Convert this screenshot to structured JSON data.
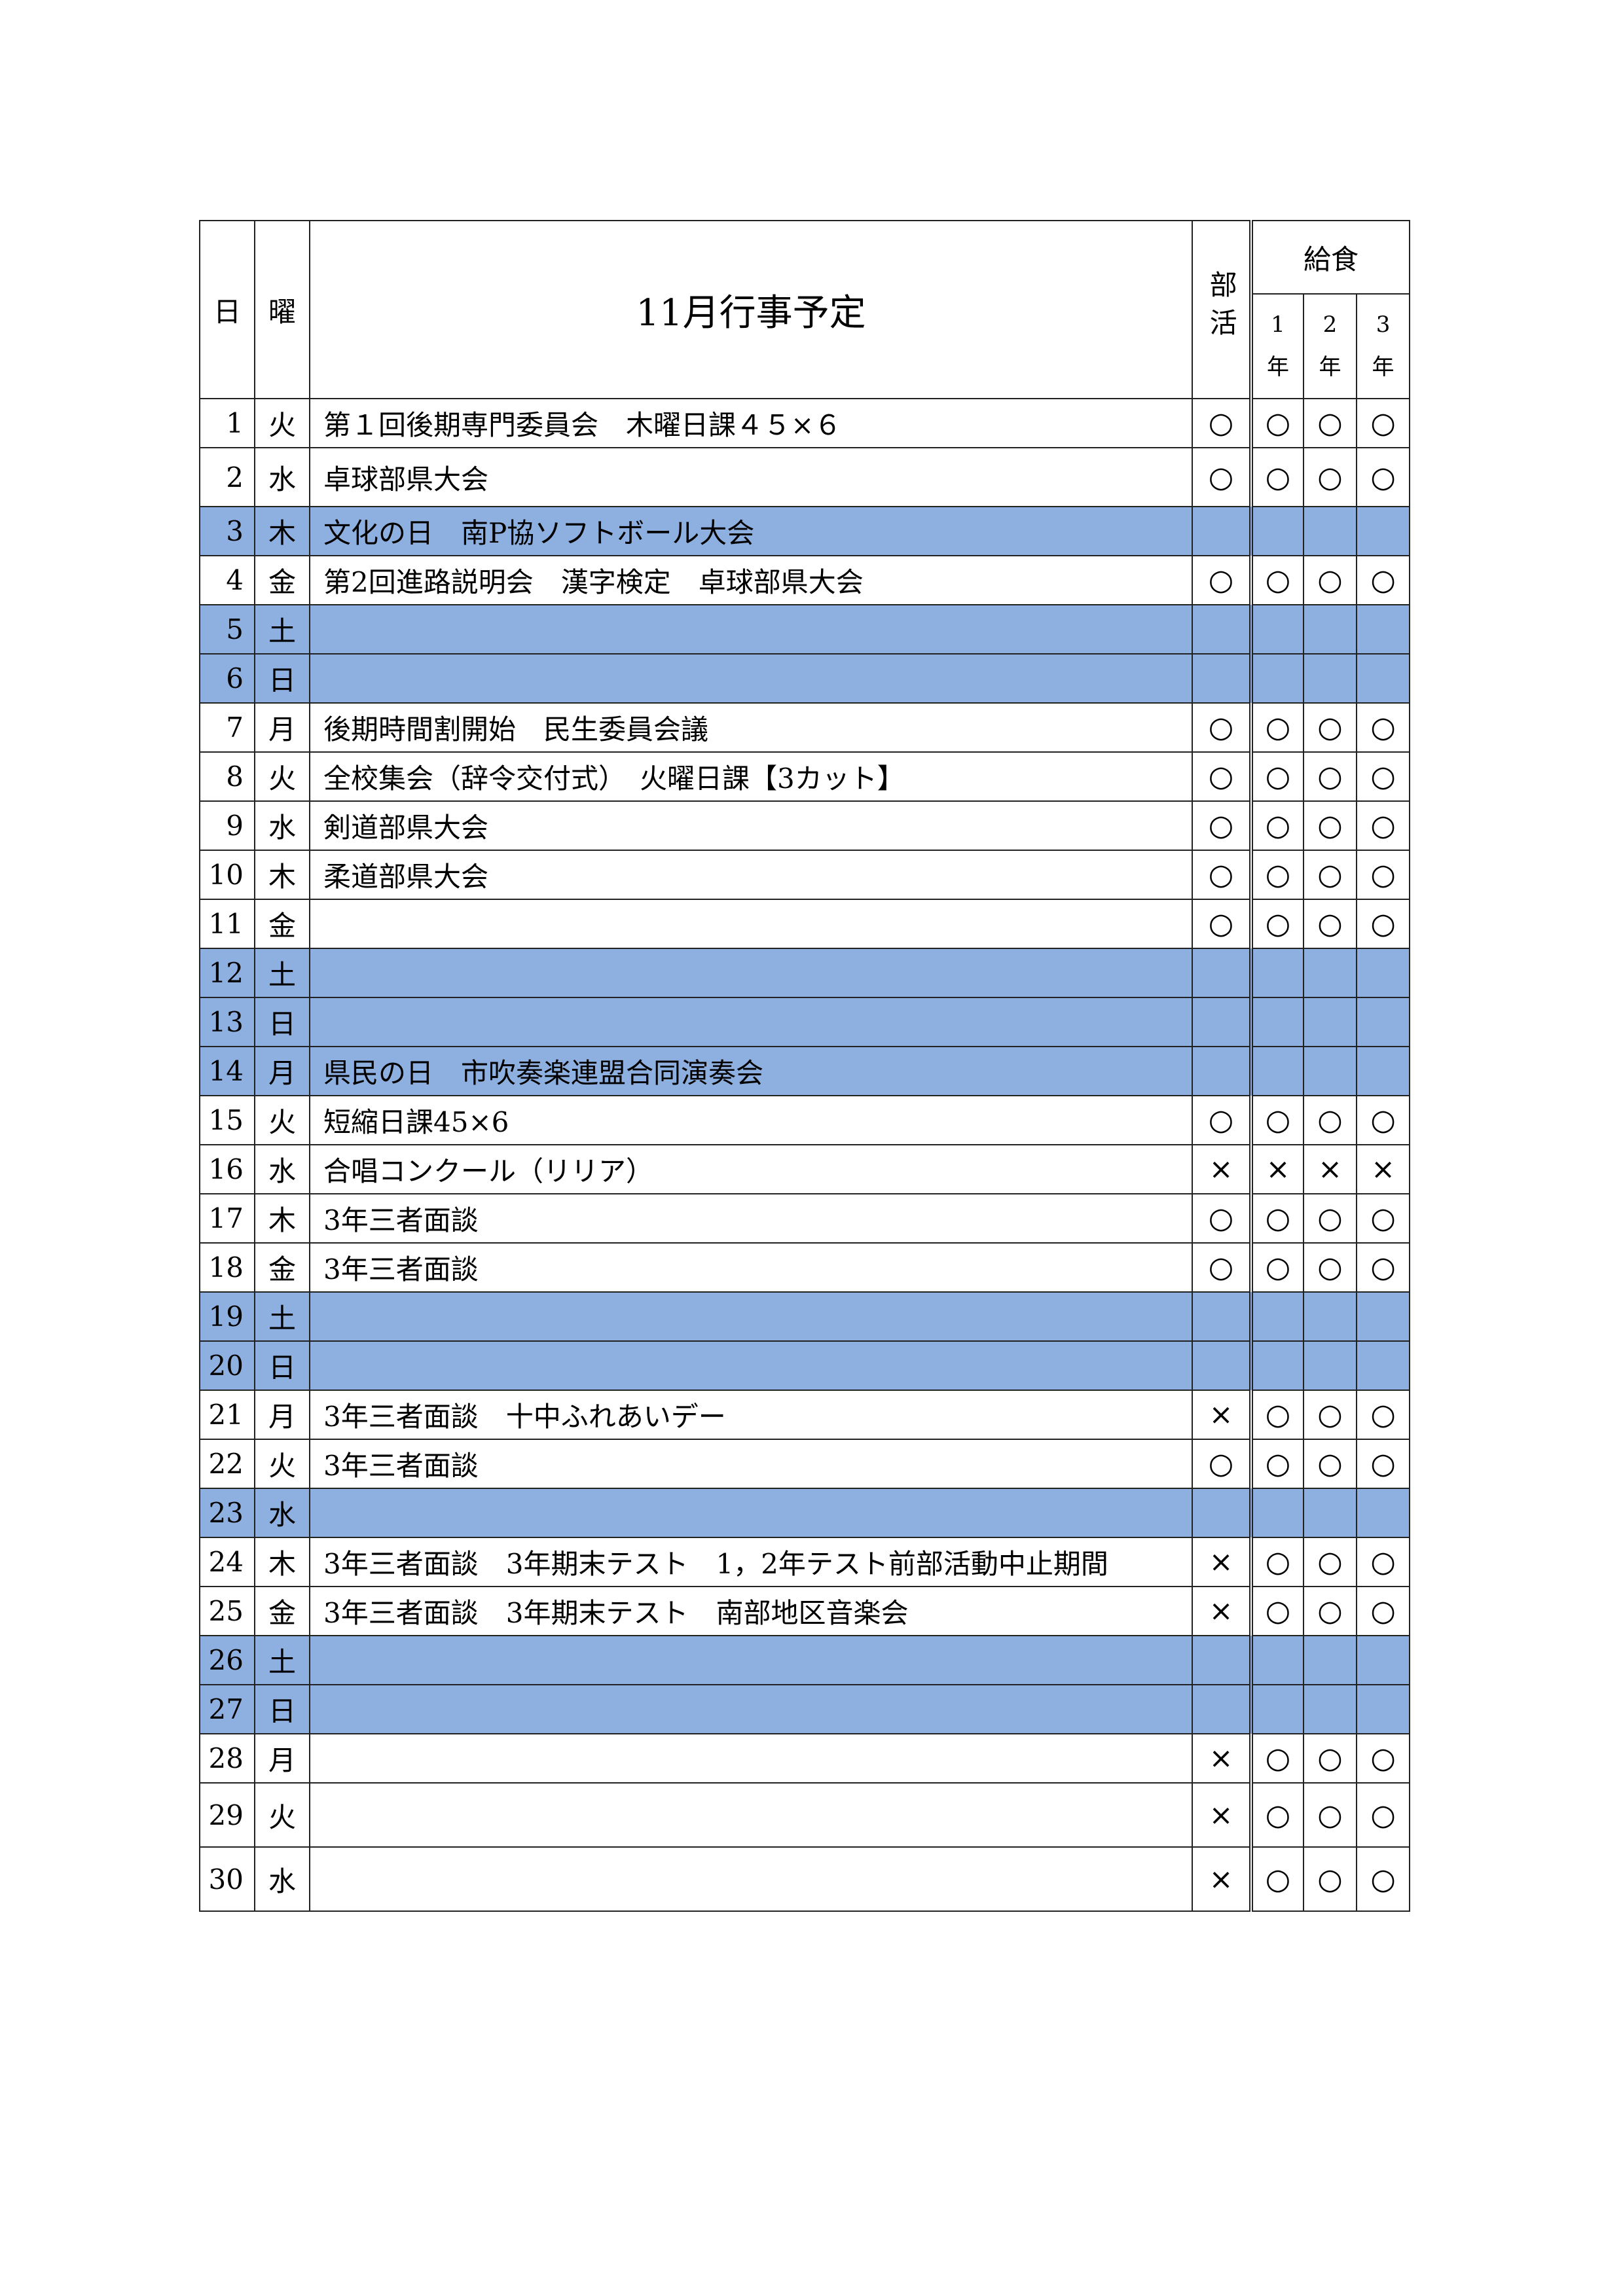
{
  "header": {
    "day_label": "日",
    "weekday_label": "曜",
    "title": "11月行事予定",
    "club_label": "部活",
    "lunch_label": "給食",
    "grades": [
      {
        "num": "1",
        "suffix": "年"
      },
      {
        "num": "2",
        "suffix": "年"
      },
      {
        "num": "3",
        "suffix": "年"
      }
    ]
  },
  "rows": [
    {
      "day": "1",
      "weekday": "火",
      "event": "第１回後期専門委員会　木曜日課４５×６",
      "club": "○",
      "g1": "○",
      "g2": "○",
      "g3": "○",
      "holiday": false
    },
    {
      "day": "2",
      "weekday": "水",
      "event": "卓球部県大会",
      "club": "○",
      "g1": "○",
      "g2": "○",
      "g3": "○",
      "holiday": false
    },
    {
      "day": "3",
      "weekday": "木",
      "event": "文化の日　南P協ソフトボール大会",
      "club": "",
      "g1": "",
      "g2": "",
      "g3": "",
      "holiday": true
    },
    {
      "day": "4",
      "weekday": "金",
      "event": "第2回進路説明会　漢字検定　卓球部県大会",
      "club": "○",
      "g1": "○",
      "g2": "○",
      "g3": "○",
      "holiday": false
    },
    {
      "day": "5",
      "weekday": "土",
      "event": "",
      "club": "",
      "g1": "",
      "g2": "",
      "g3": "",
      "holiday": true
    },
    {
      "day": "6",
      "weekday": "日",
      "event": "",
      "club": "",
      "g1": "",
      "g2": "",
      "g3": "",
      "holiday": true
    },
    {
      "day": "7",
      "weekday": "月",
      "event": "後期時間割開始　民生委員会議",
      "club": "○",
      "g1": "○",
      "g2": "○",
      "g3": "○",
      "holiday": false
    },
    {
      "day": "8",
      "weekday": "火",
      "event": "全校集会（辞令交付式）　火曜日課【3カット】",
      "club": "○",
      "g1": "○",
      "g2": "○",
      "g3": "○",
      "holiday": false
    },
    {
      "day": "9",
      "weekday": "水",
      "event": "剣道部県大会",
      "club": "○",
      "g1": "○",
      "g2": "○",
      "g3": "○",
      "holiday": false
    },
    {
      "day": "10",
      "weekday": "木",
      "event": "柔道部県大会",
      "club": "○",
      "g1": "○",
      "g2": "○",
      "g3": "○",
      "holiday": false
    },
    {
      "day": "11",
      "weekday": "金",
      "event": "",
      "club": "○",
      "g1": "○",
      "g2": "○",
      "g3": "○",
      "holiday": false
    },
    {
      "day": "12",
      "weekday": "土",
      "event": "",
      "club": "",
      "g1": "",
      "g2": "",
      "g3": "",
      "holiday": true
    },
    {
      "day": "13",
      "weekday": "日",
      "event": "",
      "club": "",
      "g1": "",
      "g2": "",
      "g3": "",
      "holiday": true
    },
    {
      "day": "14",
      "weekday": "月",
      "event": "県民の日　市吹奏楽連盟合同演奏会",
      "club": "",
      "g1": "",
      "g2": "",
      "g3": "",
      "holiday": true
    },
    {
      "day": "15",
      "weekday": "火",
      "event": "短縮日課45×6",
      "club": "○",
      "g1": "○",
      "g2": "○",
      "g3": "○",
      "holiday": false
    },
    {
      "day": "16",
      "weekday": "水",
      "event": "合唱コンクール（リリア）",
      "club": "×",
      "g1": "×",
      "g2": "×",
      "g3": "×",
      "holiday": false
    },
    {
      "day": "17",
      "weekday": "木",
      "event": "3年三者面談",
      "club": "○",
      "g1": "○",
      "g2": "○",
      "g3": "○",
      "holiday": false
    },
    {
      "day": "18",
      "weekday": "金",
      "event": "3年三者面談",
      "club": "○",
      "g1": "○",
      "g2": "○",
      "g3": "○",
      "holiday": false
    },
    {
      "day": "19",
      "weekday": "土",
      "event": "",
      "club": "",
      "g1": "",
      "g2": "",
      "g3": "",
      "holiday": true
    },
    {
      "day": "20",
      "weekday": "日",
      "event": "",
      "club": "",
      "g1": "",
      "g2": "",
      "g3": "",
      "holiday": true
    },
    {
      "day": "21",
      "weekday": "月",
      "event": "3年三者面談　十中ふれあいデー",
      "club": "×",
      "g1": "○",
      "g2": "○",
      "g3": "○",
      "holiday": false
    },
    {
      "day": "22",
      "weekday": "火",
      "event": "3年三者面談",
      "club": "○",
      "g1": "○",
      "g2": "○",
      "g3": "○",
      "holiday": false
    },
    {
      "day": "23",
      "weekday": "水",
      "event": "",
      "club": "",
      "g1": "",
      "g2": "",
      "g3": "",
      "holiday": true
    },
    {
      "day": "24",
      "weekday": "木",
      "event": "3年三者面談　3年期末テスト　1，2年テスト前部活動中止期間",
      "club": "×",
      "g1": "○",
      "g2": "○",
      "g3": "○",
      "holiday": false
    },
    {
      "day": "25",
      "weekday": "金",
      "event": "3年三者面談　3年期末テスト　南部地区音楽会",
      "club": "×",
      "g1": "○",
      "g2": "○",
      "g3": "○",
      "holiday": false
    },
    {
      "day": "26",
      "weekday": "土",
      "event": "",
      "club": "",
      "g1": "",
      "g2": "",
      "g3": "",
      "holiday": true
    },
    {
      "day": "27",
      "weekday": "日",
      "event": "",
      "club": "",
      "g1": "",
      "g2": "",
      "g3": "",
      "holiday": true
    },
    {
      "day": "28",
      "weekday": "月",
      "event": "",
      "club": "×",
      "g1": "○",
      "g2": "○",
      "g3": "○",
      "holiday": false
    },
    {
      "day": "29",
      "weekday": "火",
      "event": "",
      "club": "×",
      "g1": "○",
      "g2": "○",
      "g3": "○",
      "holiday": false
    },
    {
      "day": "30",
      "weekday": "水",
      "event": "",
      "club": "×",
      "g1": "○",
      "g2": "○",
      "g3": "○",
      "holiday": false
    }
  ]
}
